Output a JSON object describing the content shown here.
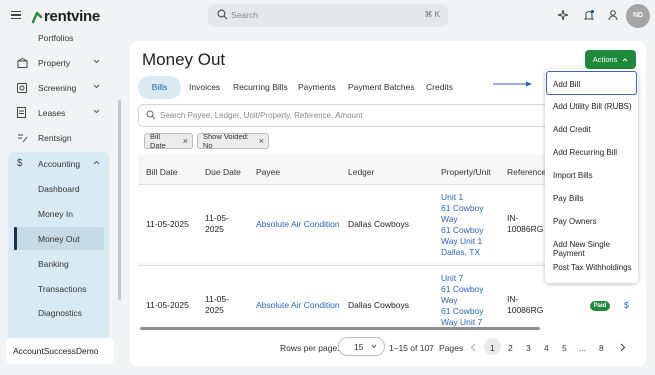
{
  "app": {
    "name": "rentvine"
  },
  "header": {
    "search_placeholder": "Search",
    "search_shortcut": "⌘ K",
    "avatar_initials": "ND"
  },
  "sidebar": {
    "partial_item": "Portfolios",
    "items": [
      {
        "label": "Property",
        "icon": "building-icon"
      },
      {
        "label": "Screening",
        "icon": "screening-icon"
      },
      {
        "label": "Leases",
        "icon": "lease-icon"
      },
      {
        "label": "Rentsign",
        "icon": "pen-icon"
      },
      {
        "label": "Accounting",
        "icon": "dollar-icon"
      }
    ],
    "accounting_sub": [
      "Dashboard",
      "Money In",
      "Money Out",
      "Banking",
      "Transactions",
      "Diagnostics"
    ],
    "active_sub": "Money Out",
    "footer": "AccountSuccessDemo"
  },
  "page": {
    "title": "Money Out",
    "actions_label": "Actions",
    "tabs": [
      "Bills",
      "Invoices",
      "Recurring Bills",
      "Payments",
      "Payment Batches",
      "Credits"
    ],
    "active_tab": "Bills",
    "filter_placeholder": "Search Payee, Ledger, Unit/Property, Reference, Amount",
    "chips": [
      "Bill Date",
      "Show Voided: No"
    ]
  },
  "table": {
    "columns": [
      "Bill Date",
      "Due Date",
      "Payee",
      "Ledger",
      "Property/Unit",
      "Reference"
    ],
    "rows": [
      {
        "bill_date": "11-05-2025",
        "due_date_l1": "11-05-",
        "due_date_l2": "2025",
        "payee": "Absolute Air Condition",
        "ledger": "Dallas Cowboys",
        "property": [
          "Unit 1",
          "61 Cowboy",
          "Way",
          "61 Cowboy",
          "Way Unit 1",
          "Dallas, TX"
        ],
        "reference_l1": "IN-",
        "reference_l2": "10086RG"
      },
      {
        "bill_date": "11-05-2025",
        "due_date_l1": "11-05-",
        "due_date_l2": "2025",
        "payee": "Absolute Air Condition",
        "ledger": "Dallas Cowboys",
        "property": [
          "Unit 7",
          "61 Cowboy",
          "Way",
          "61 Cowboy",
          "Way Unit 7"
        ],
        "reference_l1": "IN-",
        "reference_l2": "10086RG",
        "status": "Paid",
        "amount_partial": "$"
      }
    ]
  },
  "pagination": {
    "rows_per_page_label": "Rows per page:",
    "rows_per_page_value": "15",
    "range": "1–15 of 107",
    "pages_label": "Pages",
    "pages": [
      "1",
      "2",
      "3",
      "4",
      "5",
      "...",
      "8"
    ],
    "current_page": "1"
  },
  "actions_menu": {
    "items": [
      "Add Bill",
      "Add Utility Bill (RUBS)",
      "Add Credit",
      "Add Recurring Bill",
      "Import Bills",
      "Pay Bills",
      "Pay Owners",
      "Add New Single Payment",
      "Post Tax Withholdings"
    ],
    "focused": "Add Bill"
  },
  "colors": {
    "brand_green": "#1f8a3c",
    "link_blue": "#2c66b8",
    "sidebar_active": "#d8ebf4"
  }
}
